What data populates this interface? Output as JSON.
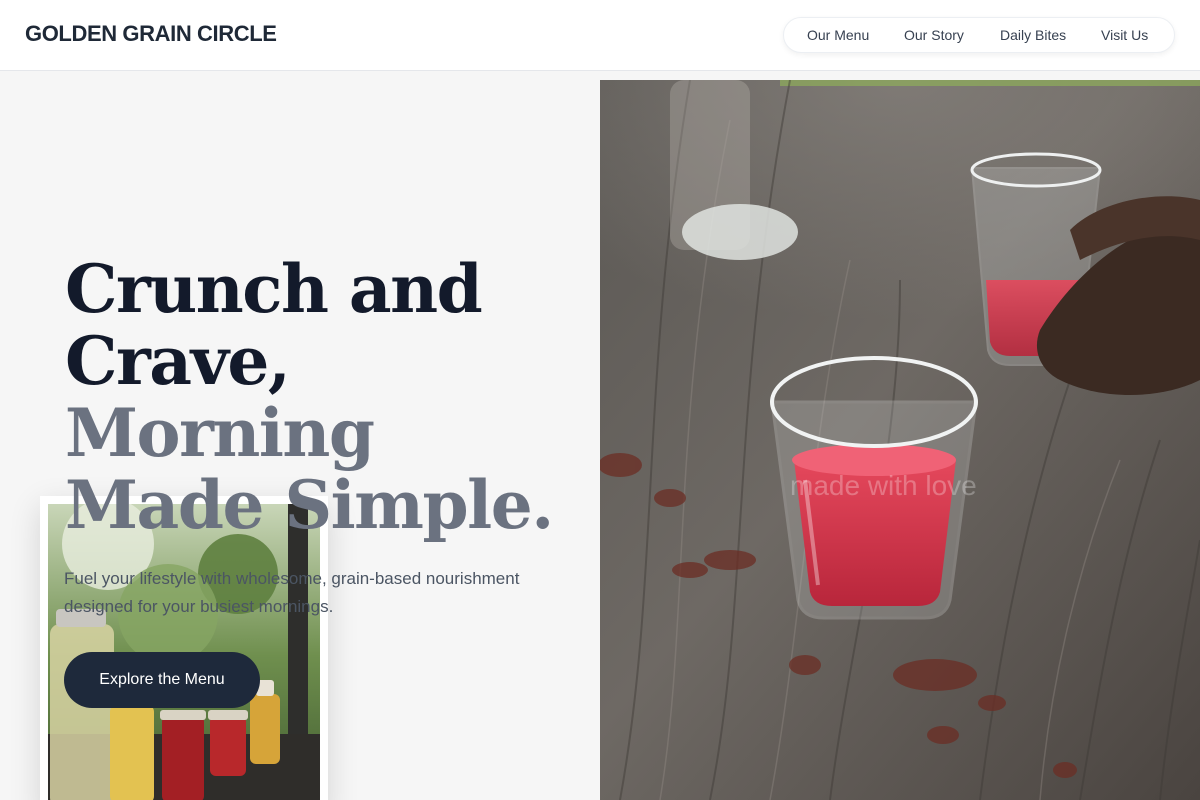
{
  "header": {
    "brand": "GOLDEN GRAIN CIRCLE",
    "nav": [
      "Our Menu",
      "Our Story",
      "Daily Bites",
      "Visit Us"
    ]
  },
  "hero": {
    "title_line1": "Crunch and",
    "title_line2": "Crave,",
    "title_line3": "Morning",
    "title_line4": "Made Simple.",
    "subtitle": "Fuel your lifestyle with wholesome, grain-based nourishment designed for your busiest mornings.",
    "cta_label": "Explore the Menu"
  },
  "photo": {
    "watermark": "made with love"
  },
  "colors": {
    "title_dark": "#131a2b",
    "title_muted": "#6b7280",
    "cta_bg": "#1e293b",
    "page_bg": "#f6f6f6"
  }
}
